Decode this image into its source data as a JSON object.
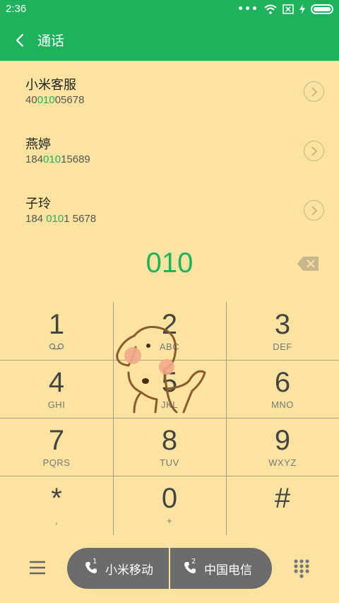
{
  "status": {
    "time": "2:36",
    "dots": "•••"
  },
  "header": {
    "title": "通话"
  },
  "contacts": [
    {
      "name": "小米客服",
      "number_pre": "40",
      "number_hl": "010",
      "number_post": "05678"
    },
    {
      "name": "燕婷",
      "number_pre": "184",
      "number_hl": "010",
      "number_post": "15689"
    },
    {
      "name": "子玲",
      "number_pre": "184 ",
      "number_hl": "010",
      "number_post": "1 5678"
    }
  ],
  "entry": {
    "digits": "010"
  },
  "keypad": [
    {
      "num": "1",
      "sub": ""
    },
    {
      "num": "2",
      "sub": "ABC"
    },
    {
      "num": "3",
      "sub": "DEF"
    },
    {
      "num": "4",
      "sub": "GHI"
    },
    {
      "num": "5",
      "sub": "JKL"
    },
    {
      "num": "6",
      "sub": "MNO"
    },
    {
      "num": "7",
      "sub": "PQRS"
    },
    {
      "num": "8",
      "sub": "TUV"
    },
    {
      "num": "9",
      "sub": "WXYZ"
    },
    {
      "num": "*",
      "sub": ","
    },
    {
      "num": "0",
      "sub": "+"
    },
    {
      "num": "#",
      "sub": ""
    }
  ],
  "sim": {
    "sim1": {
      "index": "1",
      "label": "小米移动"
    },
    "sim2": {
      "index": "2",
      "label": "中国电信"
    }
  },
  "colors": {
    "accent": "#1fb25c",
    "background": "#fde3a0",
    "sim_button": "#6b6b6b"
  }
}
